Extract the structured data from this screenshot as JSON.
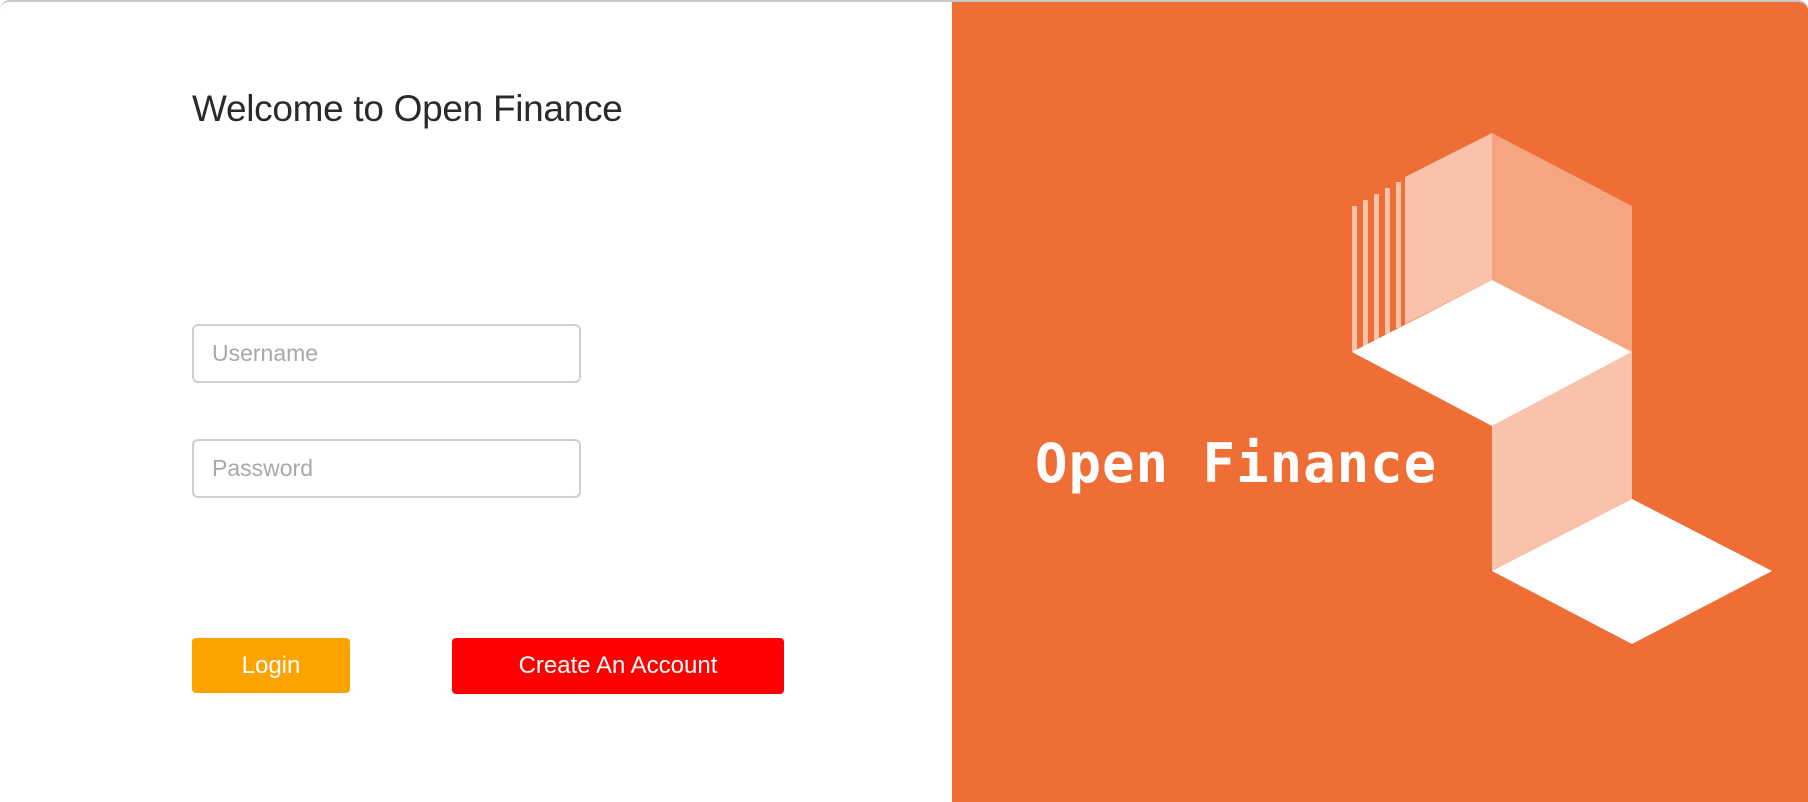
{
  "login_form": {
    "heading": "Welcome to Open Finance",
    "username_placeholder": "Username",
    "password_placeholder": "Password",
    "login_label": "Login",
    "create_account_label": "Create An Account"
  },
  "brand": {
    "name": "Open Finance",
    "logo_icon": "isometric-stairs-logo-icon"
  },
  "colors": {
    "brand_orange": "#ef6e36",
    "login_button": "#fca300",
    "create_account_button": "#ff0000"
  }
}
